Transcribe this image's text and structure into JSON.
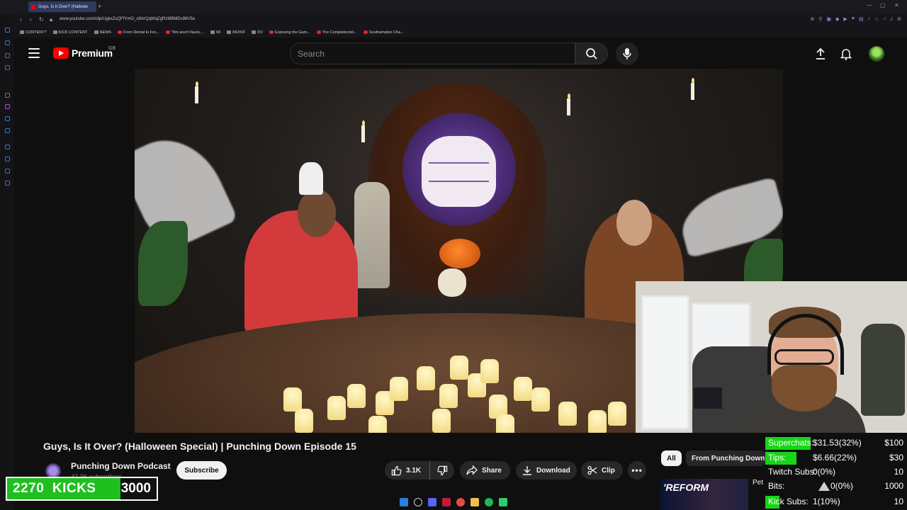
{
  "browser": {
    "tab_title": "Guys, Is It Over? (Hallowe",
    "url": "www.youtube.com/clip/UgkxZsQFfYmO_o8ArQqWqZgRzMBMDc88V5e",
    "bookmarks": [
      {
        "label": "CONTENT?",
        "icon": "folder-icon"
      },
      {
        "label": "KICK CONTENT",
        "icon": "folder-icon"
      },
      {
        "label": "NEWS",
        "icon": "folder-icon"
      },
      {
        "label": "From Denial to Fre...",
        "icon": "youtube-icon"
      },
      {
        "label": "\"We aren't Nazis,...",
        "icon": "youtube-icon"
      },
      {
        "label": "MI",
        "icon": "folder-icon"
      },
      {
        "label": "MIZKIF",
        "icon": "folder-icon"
      },
      {
        "label": "DV",
        "icon": "folder-icon"
      },
      {
        "label": "Exposing the Gam...",
        "icon": "youtube-icon"
      },
      {
        "label": "The Completionist...",
        "icon": "youtube-icon"
      },
      {
        "label": "Southampton Cha...",
        "icon": "youtube-icon"
      }
    ]
  },
  "header": {
    "logo_text": "Premium",
    "region": "GB",
    "search_placeholder": "Search"
  },
  "video": {
    "title": "Guys, Is It Over? (Halloween Special) | Punching Down Episode 15",
    "channel_name": "Punching Down Podcast",
    "channel_subs": "42.3K subscribers",
    "subscribe_label": "Subscribe",
    "like_count": "3.1K",
    "share_label": "Share",
    "download_label": "Download",
    "clip_label": "Clip"
  },
  "sidebar_chips": {
    "all_label": "All",
    "from_label": "From Punching Down"
  },
  "recommendation": {
    "thumb_text": "'REFORM",
    "title": "Pet"
  },
  "kicks": {
    "current": "2270",
    "label": "KICKS",
    "goal": "3000",
    "progress_fraction": 0.757,
    "fill_color": "#1fbf1f"
  },
  "donations": [
    {
      "label": "Superchats:",
      "value": "$31.53(32%)",
      "goal": "$100",
      "progress": 0.32
    },
    {
      "label": "Tips:",
      "value": "$6.66(22%)",
      "goal": "$30",
      "progress": 0.22
    },
    {
      "label": "Twitch Subs:",
      "value": "0(0%)",
      "goal": "10",
      "progress": 0
    },
    {
      "label": "Bits:",
      "value": "0(0%)",
      "goal": "1000",
      "progress": 0
    },
    {
      "label": "Kick Subs:",
      "value": "1(10%)",
      "goal": "10",
      "progress": 0.1
    }
  ],
  "colors": {
    "youtube_red": "#ff0000",
    "progress_green": "#16d616"
  }
}
